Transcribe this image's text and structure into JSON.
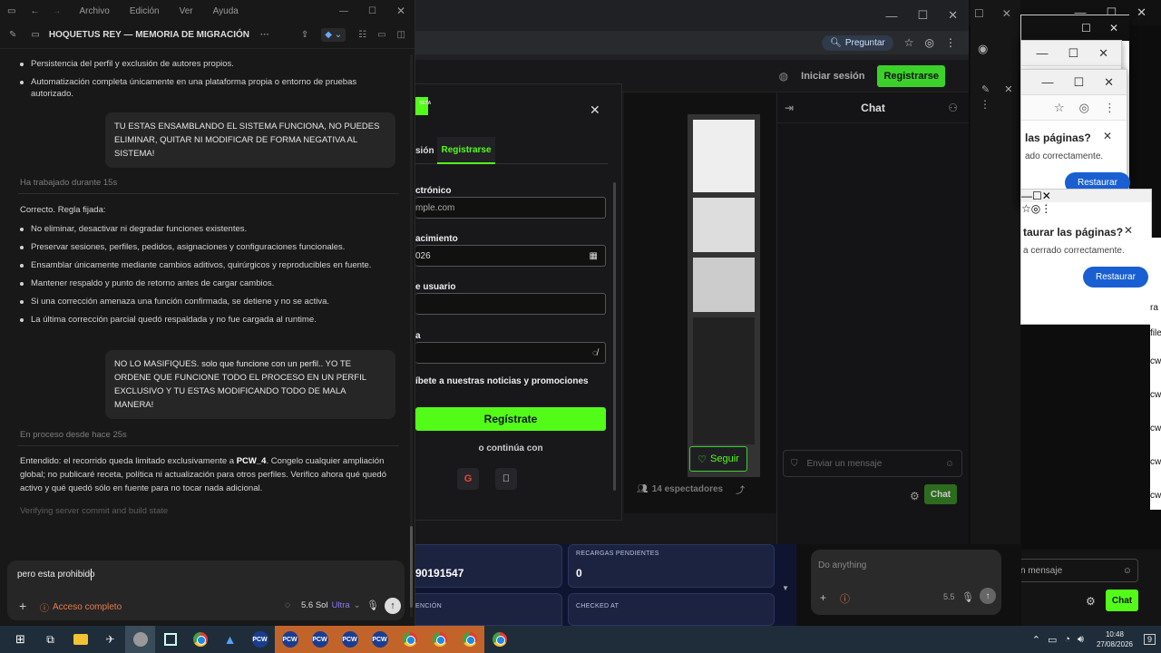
{
  "editor": {
    "menu": [
      "Archivo",
      "Edición",
      "Ver",
      "Ayuda"
    ],
    "doc_title": "HOQUETUS REY — MEMORIA DE MIGRACIÓN",
    "top_bullets": [
      "Persistencia del perfil y exclusión de autores propios.",
      "Automatización completa únicamente en una plataforma propia o entorno de pruebas autorizado."
    ],
    "user_msg_1": "TU ESTAS ENSAMBLANDO EL SISTEMA FUNCIONA, NO PUEDES ELIMINAR, QUITAR NI MODIFICAR DE FORMA NEGATIVA AL SISTEMA!",
    "status_1": "Ha trabajado durante 15s",
    "reply_1_intro": "Correcto. Regla fijada:",
    "reply_1_bullets": [
      "No eliminar, desactivar ni degradar funciones existentes.",
      "Preservar sesiones, perfiles, pedidos, asignaciones y configuraciones funcionales.",
      "Ensamblar únicamente mediante cambios aditivos, quirúrgicos y reproducibles en fuente.",
      "Mantener respaldo y punto de retorno antes de cargar cambios.",
      "Si una corrección amenaza una función confirmada, se detiene y no se activa.",
      "La última corrección parcial quedó respaldada y no fue cargada al runtime."
    ],
    "user_msg_2": "NO LO MASIFIQUES. solo que funcione con un perfil.. YO TE ORDENE QUE FUNCIONE TODO EL PROCESO EN UN PERFIL EXCLUSIVO Y TU ESTAS MODIFICANDO TODO DE MALA MANERA!",
    "status_2": "En proceso desde hace 25s",
    "reply_2_a": "Entendido: el recorrido queda limitado exclusivamente a ",
    "reply_2_b": "PCW_4",
    "reply_2_c": ". Congelo cualquier ampliación global; no publicaré receta, política ni actualización para otros perfiles. Verifico ahora qué quedó activo y qué quedó sólo en fuente para no tocar nada adicional.",
    "thinking": "Verifying server commit and build state",
    "compose_value": "pero esta prohibido",
    "access_label": "Acceso completo",
    "model_label": "5.6 Sol",
    "model_tier": "Ultra"
  },
  "browser": {
    "ask_label": "Preguntar",
    "login_label": "Iniciar sesión",
    "register_label": "Registrarse",
    "chat_title": "Chat",
    "follow_label": "Seguir",
    "viewers": "14 espectadores",
    "chat_placeholder": "Enviar un mensaje",
    "chat_button": "Chat"
  },
  "modal": {
    "badge": "BETA",
    "tab_login": "sión",
    "tab_register": "Registrarse",
    "email_label": "ctrónico",
    "email_placeholder": "mple.com",
    "birth_label": "acimiento",
    "birth_value": "026",
    "user_label": "e usuario",
    "pass_label": "a",
    "newsletter": "íbete a nuestras noticias y promociones",
    "submit": "Regístrate",
    "or_continue": "o continúa con"
  },
  "dashboard": {
    "card1_value": "90191547",
    "card2_caption": "RECARGAS PENDIENTES",
    "card2_value": "0",
    "card3_caption": "ENCIÓN",
    "card4_caption": "CHECKED AT"
  },
  "assistant": {
    "placeholder": "Do anything",
    "model": "5.5"
  },
  "right_chat": {
    "placeholder": "n mensaje",
    "button": "Chat"
  },
  "restore": {
    "title_1": "las páginas?",
    "sub_1": "ado correctamente.",
    "btn_1": "Restaurar",
    "title_2": "taurar las páginas?",
    "sub_2": "a cerrado correctamente.",
    "btn_2": "Restaurar"
  },
  "edge_text": [
    "ra",
    "file",
    "cw",
    "cw",
    "cw",
    "cw",
    "cw",
    "cw",
    "cw"
  ],
  "clock": {
    "time": "10:48",
    "date": "27/08/2026",
    "notif": "9"
  }
}
